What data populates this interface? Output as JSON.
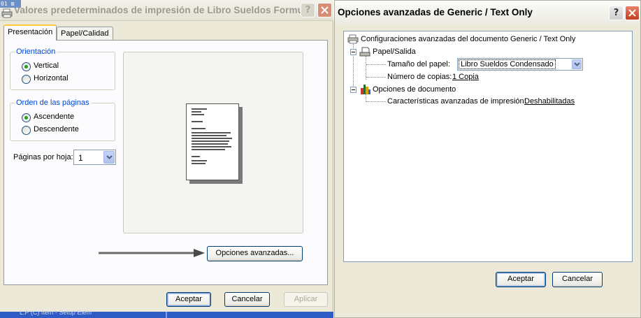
{
  "left_window": {
    "badge": "01",
    "title": "Valores predeterminados de impresión de Libro Sueldos Formul...",
    "help_label": "?",
    "tabs": [
      {
        "label": "Presentación"
      },
      {
        "label": "Papel/Calidad"
      }
    ],
    "orientation": {
      "legend": "Orientación",
      "options": [
        {
          "label": "Vertical",
          "checked": true
        },
        {
          "label": "Horizontal",
          "checked": false
        }
      ]
    },
    "page_order": {
      "legend": "Orden de las páginas",
      "options": [
        {
          "label": "Ascendente",
          "checked": true
        },
        {
          "label": "Descendente",
          "checked": false
        }
      ]
    },
    "pages_per_sheet": {
      "label": "Páginas por hoja:",
      "value": "1"
    },
    "advanced_button": "Opciones avanzadas...",
    "buttons": {
      "ok": "Aceptar",
      "cancel": "Cancelar",
      "apply": "Aplicar"
    },
    "taskbar_text": "L.P (C) Item - Setup Elem"
  },
  "right_window": {
    "title": "Opciones avanzadas de Generic / Text Only",
    "help_label": "?",
    "tree": {
      "root": "Configuraciones avanzadas del documento Generic / Text Only",
      "paper_output": "Papel/Salida",
      "paper_size_label": "Tamaño del papel:",
      "paper_size_value": "Libro Sueldos Condensado",
      "copies_label": "Número de copias:",
      "copies_value": "1 Copia",
      "doc_options": "Opciones de documento",
      "adv_print_label": "Características avanzadas de impresión:",
      "adv_print_value": "Deshabilitadas"
    },
    "buttons": {
      "ok": "Aceptar",
      "cancel": "Cancelar"
    }
  },
  "colors": {
    "dialog_bg": "#ece9d8",
    "legend_blue": "#0046d5",
    "tab_highlight": "#ffc73c",
    "radio_checked": "#21a121",
    "close_red": "#c43c1c"
  }
}
